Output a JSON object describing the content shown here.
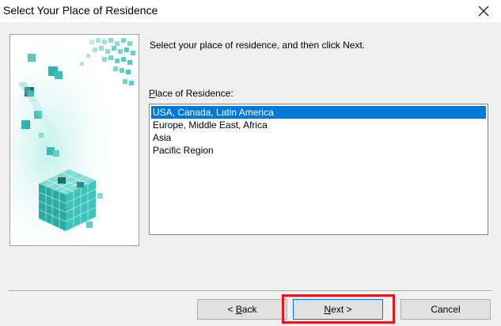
{
  "window": {
    "title": "Select Your Place of Residence",
    "close_icon": "close-icon"
  },
  "instruction": "Select your place of residence, and then click Next.",
  "list": {
    "label_mnemonic": "P",
    "label_rest": "lace of Residence:",
    "items": [
      {
        "label": "USA, Canada, Latin America",
        "selected": true
      },
      {
        "label": "Europe, Middle East, Africa",
        "selected": false
      },
      {
        "label": "Asia",
        "selected": false
      },
      {
        "label": "Pacific Region",
        "selected": false
      }
    ]
  },
  "buttons": {
    "back_prefix": "< ",
    "back_mnemonic": "B",
    "back_rest": "ack",
    "next_mnemonic": "N",
    "next_rest": "ext >",
    "cancel": "Cancel"
  },
  "colors": {
    "selection": "#0078d7",
    "highlight": "#e0191e",
    "art_teal": "#2bb5b0"
  },
  "art_icon": "teal-cubes-illustration"
}
